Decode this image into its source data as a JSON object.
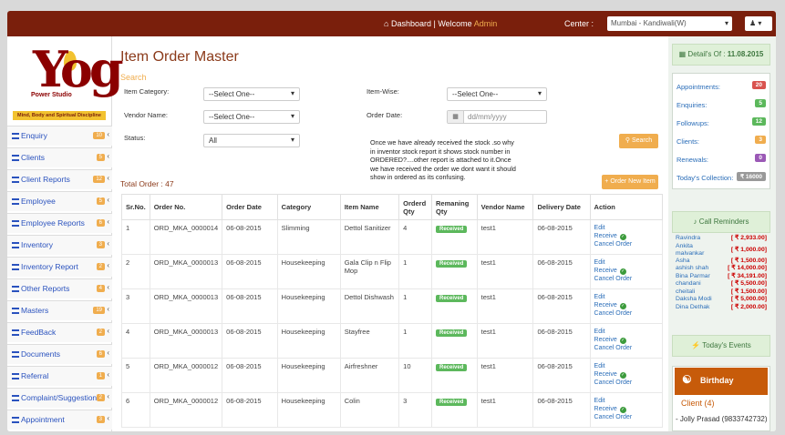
{
  "topbar": {
    "dashboard": "Dashboard",
    "welcome": "| Welcome",
    "user": "Admin",
    "center_label": "Center :",
    "center_value": "Mumbai - Kandiwali(W)"
  },
  "logo": {
    "text": "Yog",
    "brand": "Power Studio",
    "tagline": "Mind, Body and Spiritual Discipline"
  },
  "sidebar": {
    "items": [
      {
        "label": "Enquiry",
        "count": "10"
      },
      {
        "label": "Clients",
        "count": "5"
      },
      {
        "label": "Client Reports",
        "count": "12"
      },
      {
        "label": "Employee",
        "count": "5"
      },
      {
        "label": "Employee Reports",
        "count": "6"
      },
      {
        "label": "Inventory",
        "count": "3"
      },
      {
        "label": "Inventory Report",
        "count": "2"
      },
      {
        "label": "Other Reports",
        "count": "4"
      },
      {
        "label": "Masters",
        "count": "19"
      },
      {
        "label": "FeedBack",
        "count": "2"
      },
      {
        "label": "Documents",
        "count": "6"
      },
      {
        "label": "Referral",
        "count": "1"
      },
      {
        "label": "Complaint/Suggestion",
        "count": "2"
      },
      {
        "label": "Appointment",
        "count": "3"
      }
    ]
  },
  "main": {
    "title": "Item Order Master",
    "search_heading": "Search",
    "filters": {
      "category_label": "Item Category:",
      "category_value": "--Select One--",
      "itemwise_label": "Item-Wise:",
      "itemwise_value": "--Select One--",
      "vendor_label": "Vendor Name:",
      "vendor_value": "--Select One--",
      "orderdate_label": "Order Date:",
      "orderdate_placeholder": "dd/mm/yyyy",
      "status_label": "Status:",
      "status_value": "All"
    },
    "note": "Once we have already received the stock .so why in inventor stock report it shows stock number in ORDERED?....other report is attached to it.Once we have received the order we dont want it should show in ordered as its confusing.",
    "search_button": "Search",
    "new_item_button": "+ Order New Item",
    "total": "Total Order : 47",
    "columns": [
      "Sr.No.",
      "Order No.",
      "Order Date",
      "Category",
      "Item Name",
      "Orderd Qty",
      "Remaning Qty",
      "Vendor Name",
      "Delivery Date",
      "Action"
    ],
    "rows": [
      {
        "sr": "1",
        "order": "ORD_MKA_0000014",
        "date": "06-08-2015",
        "cat": "Slimming",
        "item": "Dettol Sanitizer",
        "qty": "4",
        "rem": "Received",
        "vendor": "test1",
        "delivery": "06-08-2015"
      },
      {
        "sr": "2",
        "order": "ORD_MKA_0000013",
        "date": "06-08-2015",
        "cat": "Housekeeping",
        "item": "Gala Clip n Flip Mop",
        "qty": "1",
        "rem": "Received",
        "vendor": "test1",
        "delivery": "06-08-2015"
      },
      {
        "sr": "3",
        "order": "ORD_MKA_0000013",
        "date": "06-08-2015",
        "cat": "Housekeeping",
        "item": "Dettol Dishwash",
        "qty": "1",
        "rem": "Received",
        "vendor": "test1",
        "delivery": "06-08-2015"
      },
      {
        "sr": "4",
        "order": "ORD_MKA_0000013",
        "date": "06-08-2015",
        "cat": "Housekeeping",
        "item": "Stayfree",
        "qty": "1",
        "rem": "Received",
        "vendor": "test1",
        "delivery": "06-08-2015"
      },
      {
        "sr": "5",
        "order": "ORD_MKA_0000012",
        "date": "06-08-2015",
        "cat": "Housekeeping",
        "item": "Airfreshner",
        "qty": "10",
        "rem": "Received",
        "vendor": "test1",
        "delivery": "06-08-2015"
      },
      {
        "sr": "6",
        "order": "ORD_MKA_0000012",
        "date": "06-08-2015",
        "cat": "Housekeeping",
        "item": "Colin",
        "qty": "3",
        "rem": "Received",
        "vendor": "test1",
        "delivery": "06-08-2015"
      }
    ],
    "actions": {
      "edit": "Edit",
      "receive": "Receive",
      "cancel": "Cancel Order"
    }
  },
  "right": {
    "details_label": "Detail's Of :",
    "details_date": "11.08.2015",
    "stats": [
      {
        "label": "Appointments:",
        "value": "20",
        "color": "#d9534f"
      },
      {
        "label": "Enquiries:",
        "value": "5",
        "color": "#5cb85c"
      },
      {
        "label": "Followups:",
        "value": "12",
        "color": "#5cb85c"
      },
      {
        "label": "Clients:",
        "value": "3",
        "color": "#f0ad4e"
      },
      {
        "label": "Renewals:",
        "value": "0",
        "color": "#9b59b6"
      },
      {
        "label": "Today's Collection:",
        "value": "₹ 16000",
        "color": "#999999"
      }
    ],
    "reminders_title": "Call Reminders",
    "reminders": [
      {
        "name": "Ravindra",
        "amount": "[ ₹ 2,933.00]"
      },
      {
        "name": "Ankita malvankar",
        "amount": "[ ₹ 1,000.00]"
      },
      {
        "name": "Asha",
        "amount": "[ ₹ 1,500.00]"
      },
      {
        "name": "ashish shah",
        "amount": "[ ₹ 14,000.00]"
      },
      {
        "name": "Bina Parmar",
        "amount": "[ ₹ 34,191.00]"
      },
      {
        "name": "chandani",
        "amount": "[ ₹ 5,500.00]"
      },
      {
        "name": "cheitali",
        "amount": "[ ₹ 1,500.00]"
      },
      {
        "name": "Daksha Modi",
        "amount": "[ ₹ 5,000.00]"
      },
      {
        "name": "Dina Dethak",
        "amount": "[ ₹ 2,000.00]"
      }
    ],
    "events_title": "Today's Events",
    "birthday_title": "Birthday",
    "client_count": "Client (4)",
    "client_entry": "- Jolly Prasad (9833742732)"
  }
}
